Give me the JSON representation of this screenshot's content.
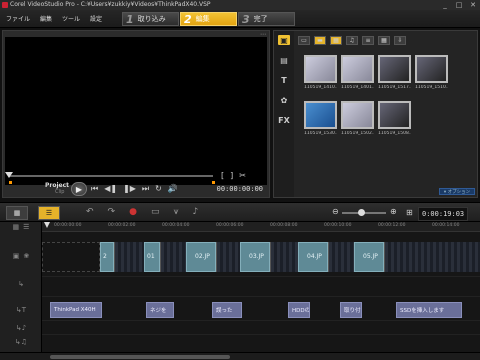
{
  "window": {
    "title": "Corel VideoStudio Pro - C:¥Users¥zukkiy¥Videos¥ThinkPadX40.VSP",
    "controls": [
      "minimize-icon",
      "maximize-icon",
      "close-icon"
    ]
  },
  "menu": [
    "ファイル",
    "編集",
    "ツール",
    "設定"
  ],
  "steps": [
    {
      "num": "1",
      "label": "取り込み",
      "active": false
    },
    {
      "num": "2",
      "label": "編集",
      "active": true
    },
    {
      "num": "3",
      "label": "完了",
      "active": false
    }
  ],
  "preview": {
    "project_label": "Project",
    "clip_label": "Clip",
    "timecode": "00:00:00:00",
    "transport": [
      "⏮",
      "◀❚",
      "❚▶",
      "⏭",
      "↻",
      "🔊"
    ],
    "inout": [
      "[",
      "]",
      "✂"
    ],
    "corner_icon": "⤢"
  },
  "library": {
    "side_tabs": [
      {
        "icon": "media-icon",
        "glyph": "▣",
        "active": true
      },
      {
        "icon": "instant-project-icon",
        "glyph": "▤",
        "active": false
      },
      {
        "icon": "title-icon",
        "glyph": "T",
        "active": false
      },
      {
        "icon": "graphic-icon",
        "glyph": "✿",
        "active": false
      },
      {
        "icon": "filter-icon",
        "glyph": "FX",
        "active": false
      }
    ],
    "toolbar": [
      {
        "icon": "folder-icon",
        "glyph": "▭",
        "active": false
      },
      {
        "icon": "video-filter-icon",
        "glyph": "▬",
        "active": true
      },
      {
        "icon": "photo-filter-icon",
        "glyph": "▦",
        "active": true
      },
      {
        "icon": "audio-filter-icon",
        "glyph": "♫",
        "active": false
      },
      {
        "icon": "list-view-icon",
        "glyph": "≡",
        "active": false
      },
      {
        "icon": "thumb-view-icon",
        "glyph": "▦",
        "active": false
      },
      {
        "icon": "import-icon",
        "glyph": "⇩",
        "active": false
      }
    ],
    "thumbnails": [
      {
        "caption": "110519_1410...",
        "style": "light"
      },
      {
        "caption": "110519_1401...",
        "style": "light"
      },
      {
        "caption": "110519_1517...",
        "style": "dark"
      },
      {
        "caption": "110519_1510...",
        "style": "dark"
      },
      {
        "caption": "110519_1530...",
        "style": "blue"
      },
      {
        "caption": "110519_1502...",
        "style": "light"
      },
      {
        "caption": "110519_1508...",
        "style": "dark"
      }
    ],
    "browse_label": "▾ オプション"
  },
  "timeline_toolbar": {
    "time": "0:00:19:03",
    "zoom_minus": "⊖",
    "zoom_plus": "⊕",
    "icons": [
      "undo-icon",
      "redo-icon",
      "record-icon",
      "smart-render-icon",
      "audio-mixer-icon",
      "auto-music-icon"
    ]
  },
  "timeline": {
    "ticks": [
      "00:00:00:00",
      "00:00:02:00",
      "00:00:04:00",
      "00:00:06:00",
      "00:00:08:00",
      "00:00:10:00",
      "00:00:12:00",
      "00:00:14:00"
    ],
    "transitions": [
      "01",
      "02.JP",
      "03.JP",
      "04.JP",
      "05.JP"
    ],
    "first_transition_label": "2",
    "titles": [
      "ThinkPad X40H",
      "ネジを",
      "誤った",
      "HDDの",
      "取り付",
      "SSDを挿入します"
    ]
  }
}
